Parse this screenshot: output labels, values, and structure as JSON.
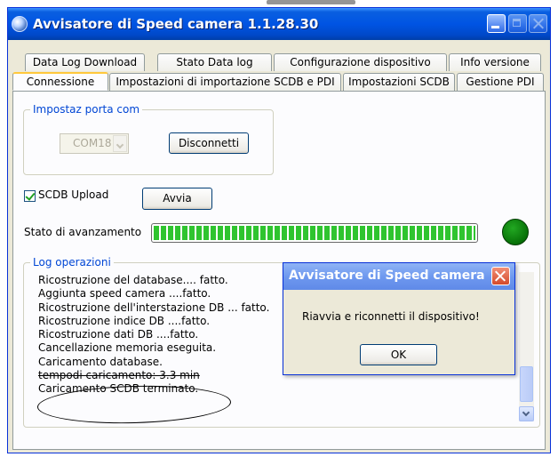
{
  "window": {
    "title": "Avvisatore di Speed camera  1.1.28.30"
  },
  "tabs_row1": [
    "Data Log Download",
    "Stato Data log",
    "Configurazione dispositivo",
    "Info versione"
  ],
  "tabs_row2": [
    "Connessione",
    "Impostazioni di importazione SCDB e PDI",
    "Impostazioni SCDB",
    "Gestione PDI"
  ],
  "active_tab": "Connessione",
  "port_group": {
    "legend": "Impostaz  porta com",
    "com_value": "COM18",
    "disconnect_label": "Disconnetti"
  },
  "upload": {
    "checkbox_label": "SCDB Upload",
    "checked": true,
    "start_label": "Avvia"
  },
  "progress": {
    "label": "Stato di avanzamento",
    "percent": 100,
    "status_color": "#077107"
  },
  "log": {
    "legend": "Log operazioni",
    "lines": [
      "Ricostruzione del database.... fatto.",
      "Aggiunta speed camera ....fatto.",
      "Ricostruzione dell'interstazione DB ... fatto.",
      "Ricostruzione indice DB ....fatto.",
      "Ricostruzione dati DB ....fatto.",
      "Cancellazione memoria eseguita.",
      "Caricamento database.",
      "tempodi caricamento:  3.3 min",
      "Caricamento SCDB terminato."
    ]
  },
  "dialog": {
    "title": "Avvisatore di Speed camera",
    "message": "Riavvia e riconnetti il dispositivo!",
    "ok_label": "OK"
  },
  "colors": {
    "titlebar": "#0054e3",
    "accent_legend": "#0046d5",
    "progress_fill": "#2fc42f",
    "dialog_close": "#d44a2b"
  }
}
